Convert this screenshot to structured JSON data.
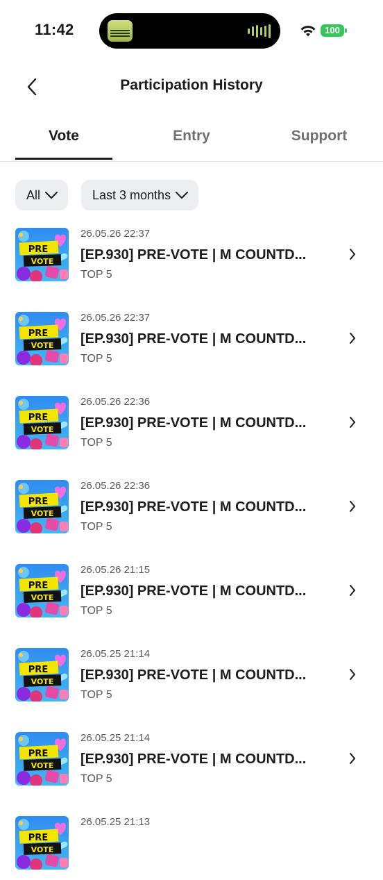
{
  "status_bar": {
    "time": "11:42",
    "battery": "100",
    "battery_color": "#35c759"
  },
  "header": {
    "title": "Participation History",
    "back_icon": "chevron-left-icon"
  },
  "tabs": [
    {
      "label": "Vote",
      "active": true
    },
    {
      "label": "Entry",
      "active": false
    },
    {
      "label": "Support",
      "active": false
    }
  ],
  "filters": {
    "category": "All",
    "period": "Last 3 months"
  },
  "thumbnail": {
    "line1": "PRE",
    "line2": "VOTE"
  },
  "items": [
    {
      "date": "26.05.26 22:37",
      "title": "[EP.930] PRE-VOTE | M COUNTD...",
      "subtitle": "TOP 5"
    },
    {
      "date": "26.05.26 22:37",
      "title": "[EP.930] PRE-VOTE | M COUNTD...",
      "subtitle": "TOP 5"
    },
    {
      "date": "26.05.26 22:36",
      "title": "[EP.930] PRE-VOTE | M COUNTD...",
      "subtitle": "TOP 5"
    },
    {
      "date": "26.05.26 22:36",
      "title": "[EP.930] PRE-VOTE | M COUNTD...",
      "subtitle": "TOP 5"
    },
    {
      "date": "26.05.26 21:15",
      "title": "[EP.930] PRE-VOTE | M COUNTD...",
      "subtitle": "TOP 5"
    },
    {
      "date": "26.05.25 21:14",
      "title": "[EP.930] PRE-VOTE | M COUNTD...",
      "subtitle": "TOP 5"
    },
    {
      "date": "26.05.25 21:14",
      "title": "[EP.930] PRE-VOTE | M COUNTD...",
      "subtitle": "TOP 5"
    },
    {
      "date": "26.05.25 21:13",
      "title": "",
      "subtitle": ""
    }
  ]
}
